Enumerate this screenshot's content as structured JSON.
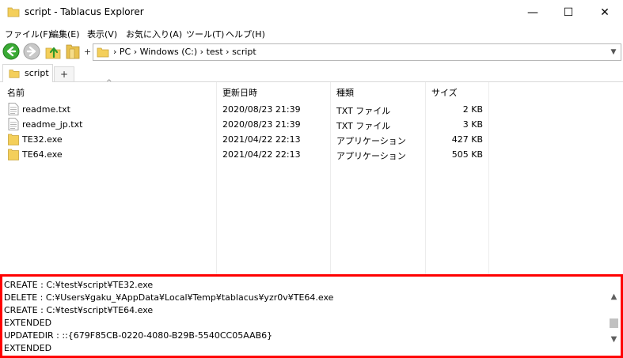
{
  "window": {
    "title": "script - Tablacus Explorer",
    "minimize_glyph": "—",
    "maximize_glyph": "☐",
    "close_glyph": "✕"
  },
  "menu": [
    "ファイル(F)",
    "編集(E)",
    "表示(V)",
    "お気に入り(A)",
    "ツール(T)",
    "ヘルプ(H)"
  ],
  "toolbar": {
    "plus_label": "+",
    "icons": [
      "back-arrow-icon",
      "forward-arrow-icon",
      "up-folder-icon",
      "folder-tree-icon"
    ]
  },
  "address": {
    "path": "› PC › Windows (C:) › test › script"
  },
  "tabs": {
    "active_label": "script",
    "add_label": "+"
  },
  "list": {
    "columns": [
      "名前",
      "更新日時",
      "種類",
      "サイズ"
    ],
    "rows": [
      {
        "name": "readme.txt",
        "modified": "2020/08/23 21:39",
        "type": "TXT ファイル",
        "size": "2 KB",
        "icon": "text-file-icon"
      },
      {
        "name": "readme_jp.txt",
        "modified": "2020/08/23 21:39",
        "type": "TXT ファイル",
        "size": "3 KB",
        "icon": "text-file-icon"
      },
      {
        "name": "TE32.exe",
        "modified": "2021/04/22 22:13",
        "type": "アプリケーション",
        "size": "427 KB",
        "icon": "exe-file-icon"
      },
      {
        "name": "TE64.exe",
        "modified": "2021/04/22 22:13",
        "type": "アプリケーション",
        "size": "505 KB",
        "icon": "exe-file-icon"
      }
    ]
  },
  "log": {
    "lines": [
      "CREATE : C:¥test¥script¥TE32.exe",
      "DELETE : C:¥Users¥gaku_¥AppData¥Local¥Temp¥tablacus¥yzr0v¥TE64.exe",
      "CREATE : C:¥test¥script¥TE64.exe",
      "EXTENDED",
      "UPDATEDIR : ::{679F85CB-0220-4080-B29B-5540CC05AAB6}",
      "EXTENDED"
    ]
  },
  "colors": {
    "highlight_border": "#ff0000",
    "folder_yellow": "#f4cf5a"
  }
}
